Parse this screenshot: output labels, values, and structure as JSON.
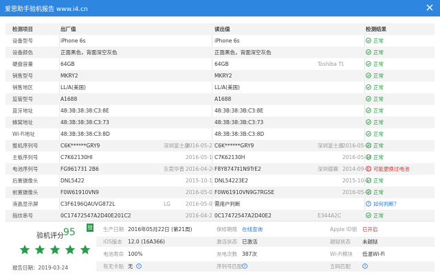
{
  "window": {
    "title": "爱思助手验机报告 www.i4.cn"
  },
  "colors": {
    "titlebar": "#2f86e0",
    "ok": "#2a9a48",
    "warn": "#e23030",
    "link": "#2a78d0"
  },
  "table": {
    "headers": {
      "item": "检测项目",
      "factory": "出厂值",
      "tested": "读出值",
      "result": "检测结果"
    },
    "rows": [
      {
        "item": "设备型号",
        "factory": "iPhone 6s",
        "fsrc": "",
        "fdate": "",
        "tested": "iPhone 6s",
        "tsrc": "",
        "tdate": "",
        "result": "正常",
        "status": "ok"
      },
      {
        "item": "设备颜色",
        "factory": "正面黑色，背面深空灰色",
        "fsrc": "",
        "fdate": "",
        "tested": "正面黑色，背面深空灰色",
        "tsrc": "",
        "tdate": "",
        "result": "正常",
        "status": "ok"
      },
      {
        "item": "硬盘容量",
        "factory": "64GB",
        "fsrc": "",
        "fdate": "",
        "tested": "64GB",
        "tsrc": "Toshiba TLC",
        "tdate": "",
        "result": "正常",
        "status": "ok"
      },
      {
        "item": "销售型号",
        "factory": "MKRY2",
        "fsrc": "",
        "fdate": "",
        "tested": "MKRY2",
        "tsrc": "",
        "tdate": "",
        "result": "正常",
        "status": "ok"
      },
      {
        "item": "销售地区",
        "factory": "LL/A(美国)",
        "fsrc": "",
        "fdate": "",
        "tested": "LL/A(美国)",
        "tsrc": "",
        "tdate": "",
        "result": "正常",
        "status": "ok"
      },
      {
        "item": "监管型号",
        "factory": "A1688",
        "fsrc": "",
        "fdate": "",
        "tested": "A1688",
        "tsrc": "",
        "tdate": "",
        "result": "正常",
        "status": "ok"
      },
      {
        "item": "蓝牙地址",
        "factory": "48:3B:38:38:C3:8E",
        "fsrc": "",
        "fdate": "",
        "tested": "48:3B:38:3B:C3:8E",
        "tsrc": "",
        "tdate": "",
        "result": "正常",
        "status": "ok"
      },
      {
        "item": "蜂窝地址",
        "factory": "48:3B:38:38:C3:73",
        "fsrc": "",
        "fdate": "",
        "tested": "48:3B:38:3B:C3:73",
        "tsrc": "",
        "tdate": "",
        "result": "正常",
        "status": "ok"
      },
      {
        "item": "Wi-Fi地址",
        "factory": "48:3B:38:38:C3:8D",
        "fsrc": "",
        "fdate": "",
        "tested": "48:3B:38:3B:C3:8D",
        "tsrc": "",
        "tdate": "",
        "result": "正常",
        "status": "ok"
      },
      {
        "item": "整机序列号",
        "factory": "C6K******GRY9",
        "fsrc": "深圳富士康",
        "fdate": "2016-05-22",
        "tested": "C6K******GRY9",
        "tsrc": "深圳富士康",
        "tdate": "2016-05-22",
        "result": "正常",
        "status": "ok"
      },
      {
        "item": "主板序列号",
        "factory": "C7K62130HI",
        "fsrc": "",
        "fdate": "2016-05-18",
        "tested": "C7K62130H",
        "tsrc": "",
        "tdate": "2016-05-18",
        "result": "正常",
        "status": "ok"
      },
      {
        "item": "电池序列号",
        "factory": "FG961731     2B6",
        "fsrc": "东莞华普",
        "fdate": "2016-04-20",
        "tested": "F8Y8747‡1N9TrE2",
        "tsrc": "深圳德赛",
        "tdate": "2014-09-11",
        "result": "可能更换过电池",
        "status": "warn"
      },
      {
        "item": "后置摄像头",
        "factory": "DNL5422",
        "fsrc": "",
        "fdate": "2015-10-13",
        "tested": "DNL54223E2",
        "tsrc": "",
        "tdate": "2015-10-13",
        "result": "正常",
        "status": "ok"
      },
      {
        "item": "前置摄像头",
        "factory": "F0W61910VN9",
        "fsrc": "",
        "fdate": "2016-05-02",
        "tested": "F0W61910VN9G7RGSE",
        "tsrc": "",
        "tdate": "2016-05-02",
        "result": "正常",
        "status": "ok"
      },
      {
        "item": "液晶显示屏",
        "factory": "C3F6196QAUVG872L",
        "fsrc": "LG",
        "fdate": "2016-05-07",
        "tested": "需用户判断",
        "tsrc": "",
        "tdate": "",
        "result": "如何判断？",
        "status": "info"
      },
      {
        "item": "指纹串号",
        "factory": "0C17472547A2D40E201C2",
        "fsrc": "",
        "fdate": "2016-04-21",
        "tested": "0C17472547A2D40E2",
        "tsrc": "E344A2C",
        "tdate": "",
        "result": "正常",
        "status": "ok"
      }
    ]
  },
  "summary": {
    "score_label": "验机评分",
    "score": "95",
    "verified_badge": "验",
    "stars": 5,
    "report_date_label": "报告日期：",
    "report_date": "2019-03-24",
    "info": [
      [
        {
          "label": "生产日期",
          "value": "2016年05月22日 (第21周)",
          "style": ""
        },
        {
          "label": "保修期限",
          "value": "在线查询",
          "style": "link"
        },
        {
          "label": "Apple ID锁",
          "value": "已开启",
          "style": "hl"
        }
      ],
      [
        {
          "label": "iOS版本",
          "value": "12.0 (16A366)",
          "style": ""
        },
        {
          "label": "激活状态",
          "value": "已激活",
          "style": ""
        },
        {
          "label": "越狱状态",
          "value": "未越狱",
          "style": ""
        }
      ],
      [
        {
          "label": "电池寿命",
          "value": "100%",
          "style": ""
        },
        {
          "label": "充电次数",
          "value": "387次",
          "style": ""
        },
        {
          "label": "Wi-Fi模块",
          "value": "低温Wi-Fi",
          "style": ""
        }
      ],
      [
        {
          "label": "有无卡贴",
          "value": "无",
          "style": ""
        },
        {
          "label": "序列号匹配",
          "value": "",
          "style": ""
        },
        {
          "label": "五码匹配",
          "value": "",
          "style": ""
        }
      ]
    ]
  }
}
